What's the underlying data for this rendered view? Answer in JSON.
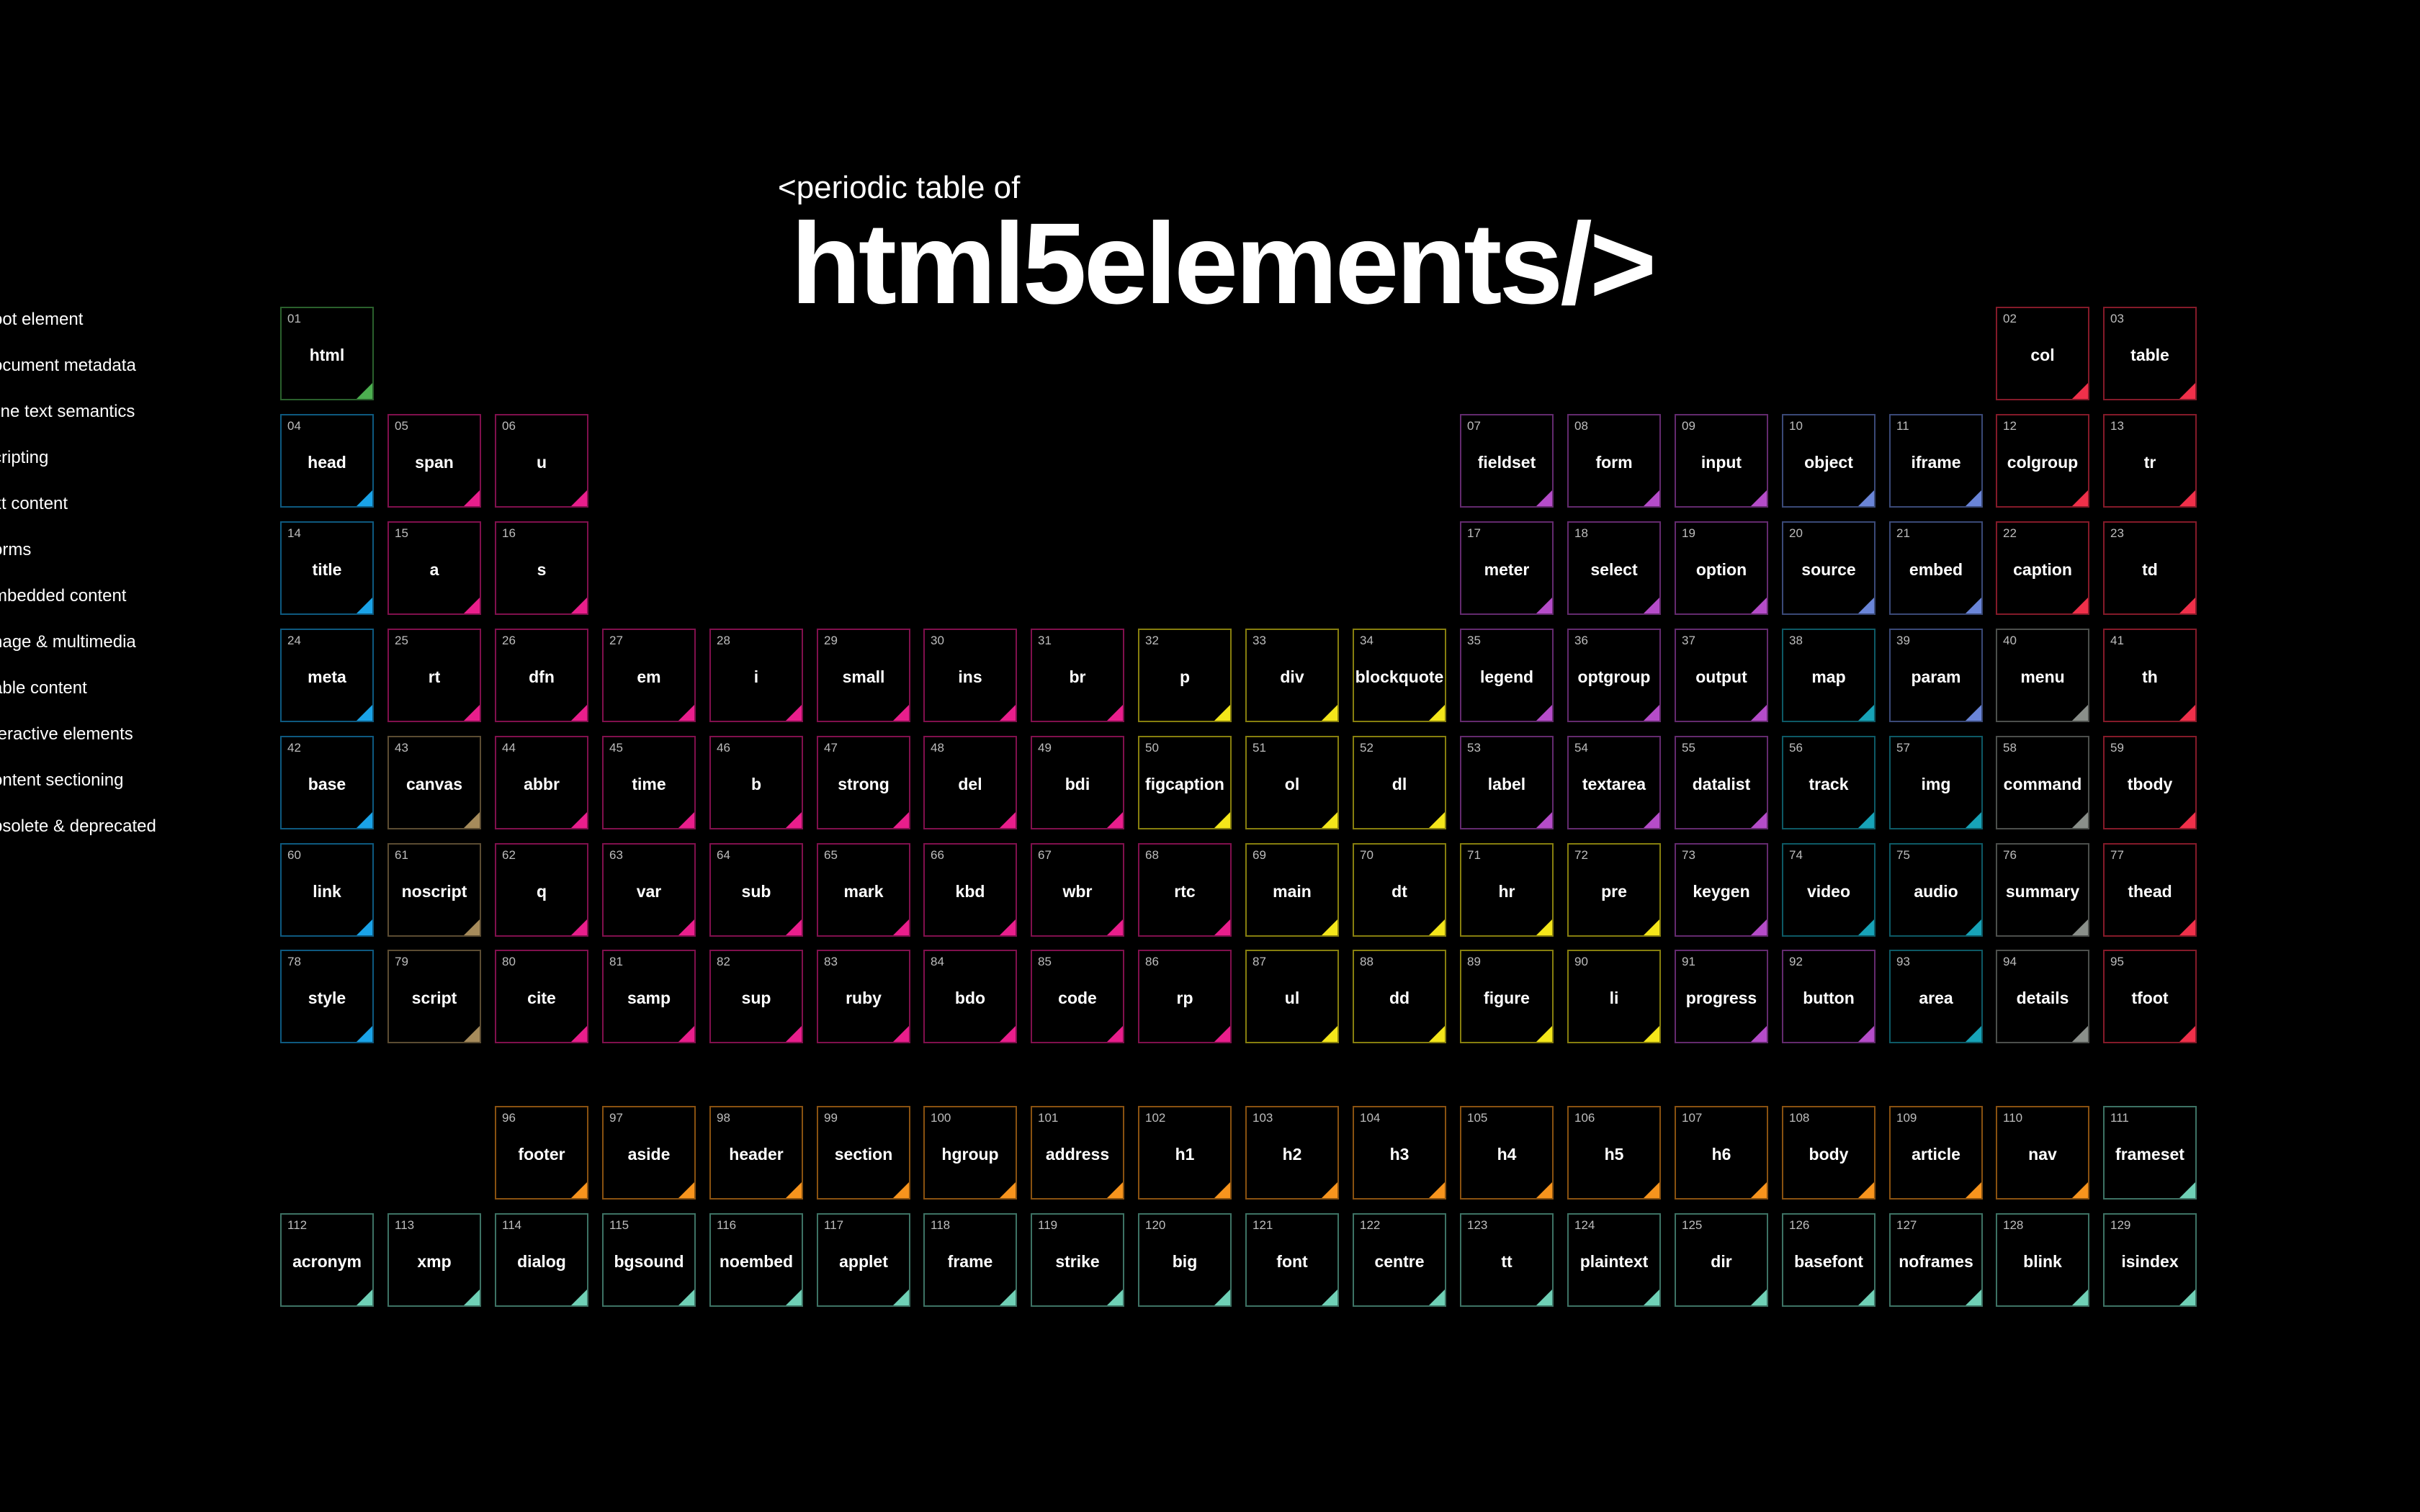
{
  "header": {
    "subtitle": "<periodic table of",
    "title": "html5elements/>"
  },
  "legend": [
    {
      "label": "oot element",
      "color": "#4caf50"
    },
    {
      "label": "ocument metadata",
      "color": "#1aa3e8"
    },
    {
      "label": "line text semantics",
      "color": "#e91e8c"
    },
    {
      "label": "cripting",
      "color": "#a68b5b"
    },
    {
      "label": "xt content",
      "color": "#f4e61a"
    },
    {
      "label": "orms",
      "color": "#b54cc9"
    },
    {
      "label": "mbedded content",
      "color": "#6a85d8"
    },
    {
      "label": "nage & multimedia",
      "color": "#17a3b8"
    },
    {
      "label": "able content",
      "color": "#f0304a"
    },
    {
      "label": "teractive elements",
      "color": "#8a8f8a"
    },
    {
      "label": "ontent sectioning",
      "color": "#f7941d"
    },
    {
      "label": "bsolete & deprecated",
      "color": "#6fd0b6"
    }
  ],
  "elements": [
    {
      "n": "01",
      "s": "html",
      "c": "#4caf50",
      "col": 0,
      "row": 0
    },
    {
      "n": "02",
      "s": "col",
      "c": "#f0304a",
      "col": 16,
      "row": 0
    },
    {
      "n": "03",
      "s": "table",
      "c": "#f0304a",
      "col": 17,
      "row": 0
    },
    {
      "n": "04",
      "s": "head",
      "c": "#1aa3e8",
      "col": 0,
      "row": 1
    },
    {
      "n": "05",
      "s": "span",
      "c": "#e91e8c",
      "col": 1,
      "row": 1
    },
    {
      "n": "06",
      "s": "u",
      "c": "#e91e8c",
      "col": 2,
      "row": 1
    },
    {
      "n": "07",
      "s": "fieldset",
      "c": "#b54cc9",
      "col": 11,
      "row": 1
    },
    {
      "n": "08",
      "s": "form",
      "c": "#b54cc9",
      "col": 12,
      "row": 1
    },
    {
      "n": "09",
      "s": "input",
      "c": "#b54cc9",
      "col": 13,
      "row": 1
    },
    {
      "n": "10",
      "s": "object",
      "c": "#6a85d8",
      "col": 14,
      "row": 1
    },
    {
      "n": "11",
      "s": "iframe",
      "c": "#6a85d8",
      "col": 15,
      "row": 1
    },
    {
      "n": "12",
      "s": "colgroup",
      "c": "#f0304a",
      "col": 16,
      "row": 1
    },
    {
      "n": "13",
      "s": "tr",
      "c": "#f0304a",
      "col": 17,
      "row": 1
    },
    {
      "n": "14",
      "s": "title",
      "c": "#1aa3e8",
      "col": 0,
      "row": 2
    },
    {
      "n": "15",
      "s": "a",
      "c": "#e91e8c",
      "col": 1,
      "row": 2
    },
    {
      "n": "16",
      "s": "s",
      "c": "#e91e8c",
      "col": 2,
      "row": 2
    },
    {
      "n": "17",
      "s": "meter",
      "c": "#b54cc9",
      "col": 11,
      "row": 2
    },
    {
      "n": "18",
      "s": "select",
      "c": "#b54cc9",
      "col": 12,
      "row": 2
    },
    {
      "n": "19",
      "s": "option",
      "c": "#b54cc9",
      "col": 13,
      "row": 2
    },
    {
      "n": "20",
      "s": "source",
      "c": "#6a85d8",
      "col": 14,
      "row": 2
    },
    {
      "n": "21",
      "s": "embed",
      "c": "#6a85d8",
      "col": 15,
      "row": 2
    },
    {
      "n": "22",
      "s": "caption",
      "c": "#f0304a",
      "col": 16,
      "row": 2
    },
    {
      "n": "23",
      "s": "td",
      "c": "#f0304a",
      "col": 17,
      "row": 2
    },
    {
      "n": "24",
      "s": "meta",
      "c": "#1aa3e8",
      "col": 0,
      "row": 3
    },
    {
      "n": "25",
      "s": "rt",
      "c": "#e91e8c",
      "col": 1,
      "row": 3
    },
    {
      "n": "26",
      "s": "dfn",
      "c": "#e91e8c",
      "col": 2,
      "row": 3
    },
    {
      "n": "27",
      "s": "em",
      "c": "#e91e8c",
      "col": 3,
      "row": 3
    },
    {
      "n": "28",
      "s": "i",
      "c": "#e91e8c",
      "col": 4,
      "row": 3
    },
    {
      "n": "29",
      "s": "small",
      "c": "#e91e8c",
      "col": 5,
      "row": 3
    },
    {
      "n": "30",
      "s": "ins",
      "c": "#e91e8c",
      "col": 6,
      "row": 3
    },
    {
      "n": "31",
      "s": "br",
      "c": "#e91e8c",
      "col": 7,
      "row": 3
    },
    {
      "n": "32",
      "s": "p",
      "c": "#f4e61a",
      "col": 8,
      "row": 3
    },
    {
      "n": "33",
      "s": "div",
      "c": "#f4e61a",
      "col": 9,
      "row": 3
    },
    {
      "n": "34",
      "s": "blockquote",
      "c": "#f4e61a",
      "col": 10,
      "row": 3
    },
    {
      "n": "35",
      "s": "legend",
      "c": "#b54cc9",
      "col": 11,
      "row": 3
    },
    {
      "n": "36",
      "s": "optgroup",
      "c": "#b54cc9",
      "col": 12,
      "row": 3
    },
    {
      "n": "37",
      "s": "output",
      "c": "#b54cc9",
      "col": 13,
      "row": 3
    },
    {
      "n": "38",
      "s": "map",
      "c": "#17a3b8",
      "col": 14,
      "row": 3
    },
    {
      "n": "39",
      "s": "param",
      "c": "#6a85d8",
      "col": 15,
      "row": 3
    },
    {
      "n": "40",
      "s": "menu",
      "c": "#8a8f8a",
      "col": 16,
      "row": 3
    },
    {
      "n": "41",
      "s": "th",
      "c": "#f0304a",
      "col": 17,
      "row": 3
    },
    {
      "n": "42",
      "s": "base",
      "c": "#1aa3e8",
      "col": 0,
      "row": 4
    },
    {
      "n": "43",
      "s": "canvas",
      "c": "#a68b5b",
      "col": 1,
      "row": 4
    },
    {
      "n": "44",
      "s": "abbr",
      "c": "#e91e8c",
      "col": 2,
      "row": 4
    },
    {
      "n": "45",
      "s": "time",
      "c": "#e91e8c",
      "col": 3,
      "row": 4
    },
    {
      "n": "46",
      "s": "b",
      "c": "#e91e8c",
      "col": 4,
      "row": 4
    },
    {
      "n": "47",
      "s": "strong",
      "c": "#e91e8c",
      "col": 5,
      "row": 4
    },
    {
      "n": "48",
      "s": "del",
      "c": "#e91e8c",
      "col": 6,
      "row": 4
    },
    {
      "n": "49",
      "s": "bdi",
      "c": "#e91e8c",
      "col": 7,
      "row": 4
    },
    {
      "n": "50",
      "s": "figcaption",
      "c": "#f4e61a",
      "col": 8,
      "row": 4
    },
    {
      "n": "51",
      "s": "ol",
      "c": "#f4e61a",
      "col": 9,
      "row": 4
    },
    {
      "n": "52",
      "s": "dl",
      "c": "#f4e61a",
      "col": 10,
      "row": 4
    },
    {
      "n": "53",
      "s": "label",
      "c": "#b54cc9",
      "col": 11,
      "row": 4
    },
    {
      "n": "54",
      "s": "textarea",
      "c": "#b54cc9",
      "col": 12,
      "row": 4
    },
    {
      "n": "55",
      "s": "datalist",
      "c": "#b54cc9",
      "col": 13,
      "row": 4
    },
    {
      "n": "56",
      "s": "track",
      "c": "#17a3b8",
      "col": 14,
      "row": 4
    },
    {
      "n": "57",
      "s": "img",
      "c": "#17a3b8",
      "col": 15,
      "row": 4
    },
    {
      "n": "58",
      "s": "command",
      "c": "#8a8f8a",
      "col": 16,
      "row": 4
    },
    {
      "n": "59",
      "s": "tbody",
      "c": "#f0304a",
      "col": 17,
      "row": 4
    },
    {
      "n": "60",
      "s": "link",
      "c": "#1aa3e8",
      "col": 0,
      "row": 5
    },
    {
      "n": "61",
      "s": "noscript",
      "c": "#a68b5b",
      "col": 1,
      "row": 5
    },
    {
      "n": "62",
      "s": "q",
      "c": "#e91e8c",
      "col": 2,
      "row": 5
    },
    {
      "n": "63",
      "s": "var",
      "c": "#e91e8c",
      "col": 3,
      "row": 5
    },
    {
      "n": "64",
      "s": "sub",
      "c": "#e91e8c",
      "col": 4,
      "row": 5
    },
    {
      "n": "65",
      "s": "mark",
      "c": "#e91e8c",
      "col": 5,
      "row": 5
    },
    {
      "n": "66",
      "s": "kbd",
      "c": "#e91e8c",
      "col": 6,
      "row": 5
    },
    {
      "n": "67",
      "s": "wbr",
      "c": "#e91e8c",
      "col": 7,
      "row": 5
    },
    {
      "n": "68",
      "s": "rtc",
      "c": "#e91e8c",
      "col": 8,
      "row": 5
    },
    {
      "n": "69",
      "s": "main",
      "c": "#f4e61a",
      "col": 9,
      "row": 5
    },
    {
      "n": "70",
      "s": "dt",
      "c": "#f4e61a",
      "col": 10,
      "row": 5
    },
    {
      "n": "71",
      "s": "hr",
      "c": "#f4e61a",
      "col": 11,
      "row": 5
    },
    {
      "n": "72",
      "s": "pre",
      "c": "#f4e61a",
      "col": 12,
      "row": 5
    },
    {
      "n": "73",
      "s": "keygen",
      "c": "#b54cc9",
      "col": 13,
      "row": 5
    },
    {
      "n": "74",
      "s": "video",
      "c": "#17a3b8",
      "col": 14,
      "row": 5
    },
    {
      "n": "75",
      "s": "audio",
      "c": "#17a3b8",
      "col": 15,
      "row": 5
    },
    {
      "n": "76",
      "s": "summary",
      "c": "#8a8f8a",
      "col": 16,
      "row": 5
    },
    {
      "n": "77",
      "s": "thead",
      "c": "#f0304a",
      "col": 17,
      "row": 5
    },
    {
      "n": "78",
      "s": "style",
      "c": "#1aa3e8",
      "col": 0,
      "row": 6
    },
    {
      "n": "79",
      "s": "script",
      "c": "#a68b5b",
      "col": 1,
      "row": 6
    },
    {
      "n": "80",
      "s": "cite",
      "c": "#e91e8c",
      "col": 2,
      "row": 6
    },
    {
      "n": "81",
      "s": "samp",
      "c": "#e91e8c",
      "col": 3,
      "row": 6
    },
    {
      "n": "82",
      "s": "sup",
      "c": "#e91e8c",
      "col": 4,
      "row": 6
    },
    {
      "n": "83",
      "s": "ruby",
      "c": "#e91e8c",
      "col": 5,
      "row": 6
    },
    {
      "n": "84",
      "s": "bdo",
      "c": "#e91e8c",
      "col": 6,
      "row": 6
    },
    {
      "n": "85",
      "s": "code",
      "c": "#e91e8c",
      "col": 7,
      "row": 6
    },
    {
      "n": "86",
      "s": "rp",
      "c": "#e91e8c",
      "col": 8,
      "row": 6
    },
    {
      "n": "87",
      "s": "ul",
      "c": "#f4e61a",
      "col": 9,
      "row": 6
    },
    {
      "n": "88",
      "s": "dd",
      "c": "#f4e61a",
      "col": 10,
      "row": 6
    },
    {
      "n": "89",
      "s": "figure",
      "c": "#f4e61a",
      "col": 11,
      "row": 6
    },
    {
      "n": "90",
      "s": "li",
      "c": "#f4e61a",
      "col": 12,
      "row": 6
    },
    {
      "n": "91",
      "s": "progress",
      "c": "#b54cc9",
      "col": 13,
      "row": 6
    },
    {
      "n": "92",
      "s": "button",
      "c": "#b54cc9",
      "col": 14,
      "row": 6
    },
    {
      "n": "93",
      "s": "area",
      "c": "#17a3b8",
      "col": 15,
      "row": 6
    },
    {
      "n": "94",
      "s": "details",
      "c": "#8a8f8a",
      "col": 16,
      "row": 6
    },
    {
      "n": "95",
      "s": "tfoot",
      "c": "#f0304a",
      "col": 17,
      "row": 6
    },
    {
      "n": "96",
      "s": "footer",
      "c": "#f7941d",
      "col": 2,
      "row": 7
    },
    {
      "n": "97",
      "s": "aside",
      "c": "#f7941d",
      "col": 3,
      "row": 7
    },
    {
      "n": "98",
      "s": "header",
      "c": "#f7941d",
      "col": 4,
      "row": 7
    },
    {
      "n": "99",
      "s": "section",
      "c": "#f7941d",
      "col": 5,
      "row": 7
    },
    {
      "n": "100",
      "s": "hgroup",
      "c": "#f7941d",
      "col": 6,
      "row": 7
    },
    {
      "n": "101",
      "s": "address",
      "c": "#f7941d",
      "col": 7,
      "row": 7
    },
    {
      "n": "102",
      "s": "h1",
      "c": "#f7941d",
      "col": 8,
      "row": 7
    },
    {
      "n": "103",
      "s": "h2",
      "c": "#f7941d",
      "col": 9,
      "row": 7
    },
    {
      "n": "104",
      "s": "h3",
      "c": "#f7941d",
      "col": 10,
      "row": 7
    },
    {
      "n": "105",
      "s": "h4",
      "c": "#f7941d",
      "col": 11,
      "row": 7
    },
    {
      "n": "106",
      "s": "h5",
      "c": "#f7941d",
      "col": 12,
      "row": 7
    },
    {
      "n": "107",
      "s": "h6",
      "c": "#f7941d",
      "col": 13,
      "row": 7
    },
    {
      "n": "108",
      "s": "body",
      "c": "#f7941d",
      "col": 14,
      "row": 7
    },
    {
      "n": "109",
      "s": "article",
      "c": "#f7941d",
      "col": 15,
      "row": 7
    },
    {
      "n": "110",
      "s": "nav",
      "c": "#f7941d",
      "col": 16,
      "row": 7
    },
    {
      "n": "111",
      "s": "frameset",
      "c": "#6fd0b6",
      "col": 17,
      "row": 7
    },
    {
      "n": "112",
      "s": "acronym",
      "c": "#6fd0b6",
      "col": 0,
      "row": 8
    },
    {
      "n": "113",
      "s": "xmp",
      "c": "#6fd0b6",
      "col": 1,
      "row": 8
    },
    {
      "n": "114",
      "s": "dialog",
      "c": "#6fd0b6",
      "col": 2,
      "row": 8
    },
    {
      "n": "115",
      "s": "bgsound",
      "c": "#6fd0b6",
      "col": 3,
      "row": 8
    },
    {
      "n": "116",
      "s": "noembed",
      "c": "#6fd0b6",
      "col": 4,
      "row": 8
    },
    {
      "n": "117",
      "s": "applet",
      "c": "#6fd0b6",
      "col": 5,
      "row": 8
    },
    {
      "n": "118",
      "s": "frame",
      "c": "#6fd0b6",
      "col": 6,
      "row": 8
    },
    {
      "n": "119",
      "s": "strike",
      "c": "#6fd0b6",
      "col": 7,
      "row": 8
    },
    {
      "n": "120",
      "s": "big",
      "c": "#6fd0b6",
      "col": 8,
      "row": 8
    },
    {
      "n": "121",
      "s": "font",
      "c": "#6fd0b6",
      "col": 9,
      "row": 8
    },
    {
      "n": "122",
      "s": "centre",
      "c": "#6fd0b6",
      "col": 10,
      "row": 8
    },
    {
      "n": "123",
      "s": "tt",
      "c": "#6fd0b6",
      "col": 11,
      "row": 8
    },
    {
      "n": "124",
      "s": "plaintext",
      "c": "#6fd0b6",
      "col": 12,
      "row": 8
    },
    {
      "n": "125",
      "s": "dir",
      "c": "#6fd0b6",
      "col": 13,
      "row": 8
    },
    {
      "n": "126",
      "s": "basefont",
      "c": "#6fd0b6",
      "col": 14,
      "row": 8
    },
    {
      "n": "127",
      "s": "noframes",
      "c": "#6fd0b6",
      "col": 15,
      "row": 8
    },
    {
      "n": "128",
      "s": "blink",
      "c": "#6fd0b6",
      "col": 16,
      "row": 8
    },
    {
      "n": "129",
      "s": "isindex",
      "c": "#6fd0b6",
      "col": 17,
      "row": 8
    }
  ]
}
